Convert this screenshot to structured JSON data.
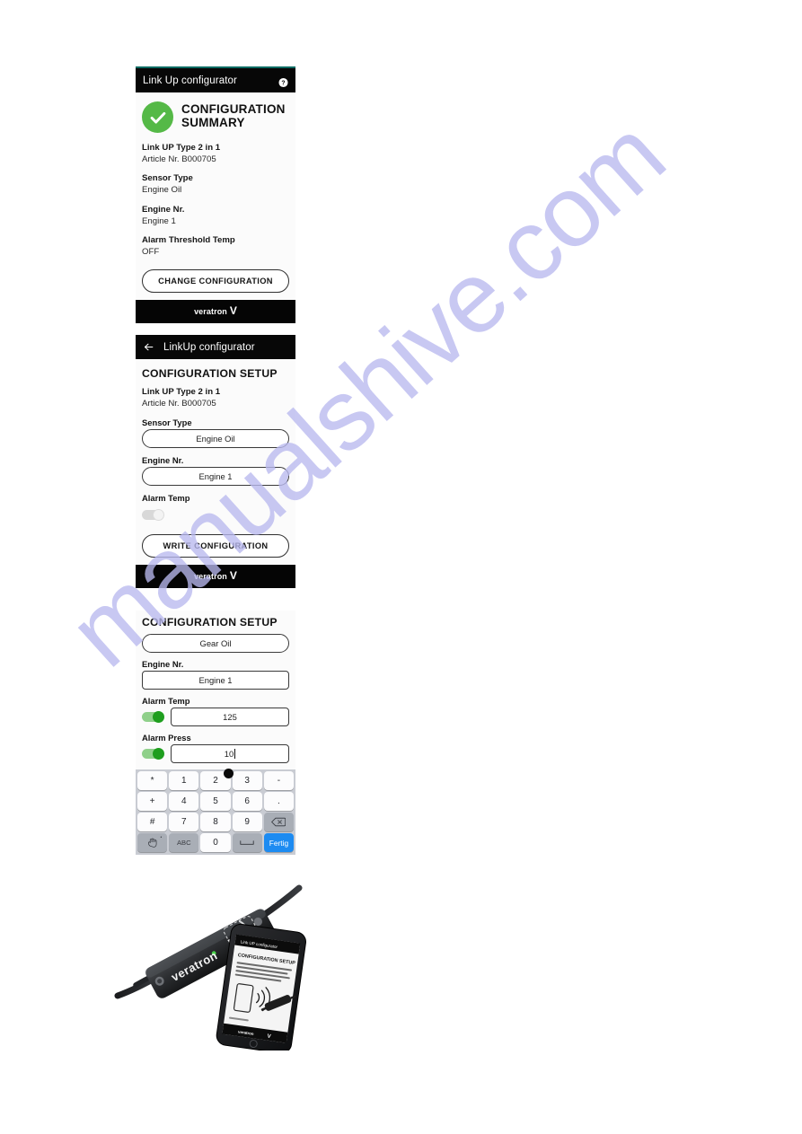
{
  "watermark": {
    "text": "manualshive.com"
  },
  "panel_summary": {
    "appbar": {
      "title": "Link Up configurator",
      "help_icon": "help-circle-icon"
    },
    "status_icon": "check-circle-icon",
    "heading": "CONFIGURATION SUMMARY",
    "product_name": "Link UP Type 2 in 1",
    "article": "Article Nr. B000705",
    "fields": [
      {
        "label": "Sensor Type",
        "value": "Engine Oil"
      },
      {
        "label": "Engine Nr.",
        "value": "Engine 1"
      },
      {
        "label": "Alarm Threshold Temp",
        "value": "OFF"
      }
    ],
    "action_button": "CHANGE CONFIGURATION",
    "brand": {
      "word": "veratron",
      "mark": "V"
    }
  },
  "panel_setup": {
    "appbar": {
      "title": "LinkUp configurator",
      "back_icon": "arrow-left-icon"
    },
    "heading": "CONFIGURATION SETUP",
    "product_name": "Link UP Type 2 in 1",
    "article": "Article Nr. B000705",
    "sensor_type": {
      "label": "Sensor Type",
      "value": "Engine Oil"
    },
    "engine_nr": {
      "label": "Engine Nr.",
      "value": "Engine 1"
    },
    "alarm_temp": {
      "label": "Alarm Temp",
      "state": "off"
    },
    "action_button": "WRITE CONFIGURATION",
    "brand": {
      "word": "veratron",
      "mark": "V"
    }
  },
  "panel_keyboard": {
    "heading": "CONFIGURATION SETUP",
    "sensor_type_value": "Gear Oil",
    "engine_nr": {
      "label": "Engine Nr.",
      "value": "Engine 1"
    },
    "alarm_temp": {
      "label": "Alarm Temp",
      "value": "125",
      "state": "on"
    },
    "alarm_press": {
      "label": "Alarm Press",
      "value": "10",
      "state": "on"
    },
    "keyboard": {
      "rows": [
        [
          {
            "label": "*",
            "style": "light"
          },
          {
            "label": "1",
            "style": "light"
          },
          {
            "label": "2",
            "style": "light"
          },
          {
            "label": "3",
            "style": "light"
          },
          {
            "label": "-",
            "style": "light"
          }
        ],
        [
          {
            "label": "+",
            "style": "light"
          },
          {
            "label": "4",
            "style": "light"
          },
          {
            "label": "5",
            "style": "light"
          },
          {
            "label": "6",
            "style": "light"
          },
          {
            "label": ".",
            "style": "light"
          }
        ],
        [
          {
            "label": "#",
            "style": "light"
          },
          {
            "label": "7",
            "style": "light"
          },
          {
            "label": "8",
            "style": "light"
          },
          {
            "label": "9",
            "style": "light"
          },
          {
            "label": "⌫",
            "style": "dark",
            "icon": "backspace-icon"
          }
        ],
        [
          {
            "label": "✋",
            "style": "dark",
            "icon": "handwriting-icon"
          },
          {
            "label": "ABC",
            "style": "dark"
          },
          {
            "label": "0",
            "style": "light"
          },
          {
            "label": "⌴",
            "style": "dark",
            "icon": "space-icon"
          },
          {
            "label": "Fertig",
            "style": "accent"
          }
        ]
      ]
    }
  },
  "photo": {
    "caption_alt": "veratron Link Up sensor with smartphone showing NFC configuration screen",
    "device_brand": "veratron",
    "phone_screen": {
      "appbar_title": "Link UP configurator",
      "heading": "CONFIGURATION SETUP",
      "brand": "veratron"
    }
  }
}
